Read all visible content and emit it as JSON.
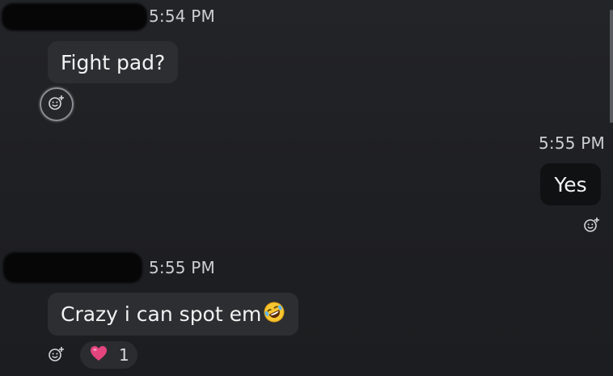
{
  "messages": [
    {
      "sender": "other",
      "time": "5:54 PM",
      "text": "Fight pad?"
    },
    {
      "sender": "me",
      "time": "5:55 PM",
      "text": "Yes"
    },
    {
      "sender": "other",
      "time": "5:55 PM",
      "text": "Crazy i can spot em",
      "reactions": [
        {
          "icon": "heart-emoji",
          "count": "1"
        }
      ]
    }
  ],
  "icons": {
    "add_reaction": "add-reaction-icon",
    "laughing_emoji": "rolling-on-floor-laughing-emoji",
    "heart": "heart-emoji"
  },
  "colors": {
    "background": "#1f2023",
    "incoming_bubble": "#2d2e31",
    "outgoing_bubble": "#101113",
    "heart": "#e4457c"
  }
}
